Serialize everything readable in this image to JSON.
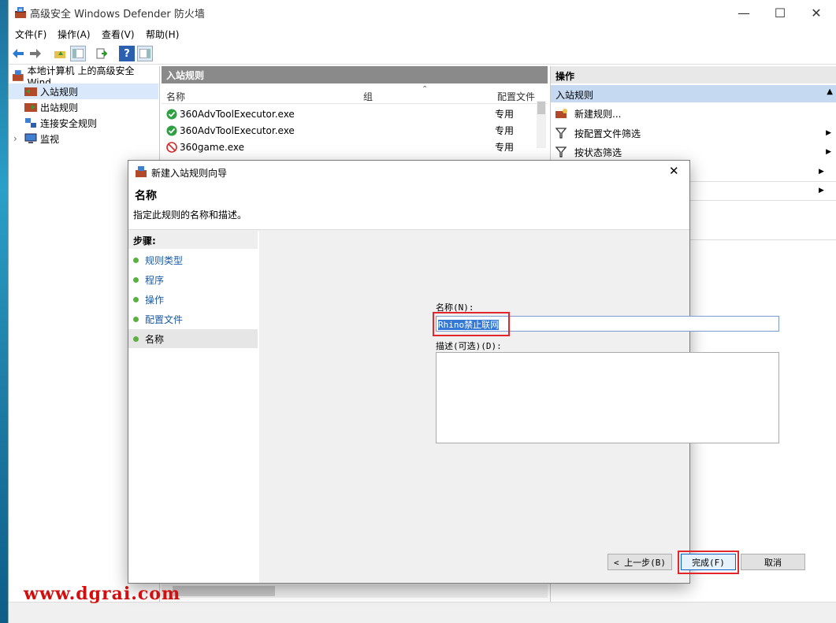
{
  "window": {
    "title": "高级安全 Windows Defender 防火墙"
  },
  "menu": [
    "文件(F)",
    "操作(A)",
    "查看(V)",
    "帮助(H)"
  ],
  "tree": {
    "root": "本地计算机 上的高级安全 Wind",
    "items": [
      "入站规则",
      "出站规则",
      "连接安全规则",
      "监视"
    ]
  },
  "middle": {
    "header": "入站规则",
    "columns": [
      "名称",
      "组",
      "配置文件"
    ],
    "rows": [
      {
        "name": "360AdvToolExecutor.exe",
        "profile": "专用",
        "status": "allow"
      },
      {
        "name": "360AdvToolExecutor.exe",
        "profile": "专用",
        "status": "allow"
      },
      {
        "name": "360game.exe",
        "profile": "专用",
        "status": "block"
      }
    ]
  },
  "actions": {
    "header": "操作",
    "sub": "入站规则",
    "items": [
      "新建规则...",
      "按配置文件筛选",
      "按状态筛选"
    ]
  },
  "dialog": {
    "title": "新建入站规则向导",
    "heading": "名称",
    "subheading": "指定此规则的名称和描述。",
    "steps_title": "步骤:",
    "steps": [
      "规则类型",
      "程序",
      "操作",
      "配置文件",
      "名称"
    ],
    "name_label": "名称(N):",
    "name_value": "Rhino禁止联网",
    "desc_label": "描述(可选)(D):",
    "back_button": "< 上一步(B)",
    "finish_button": "完成(F)",
    "cancel_button": "取消"
  },
  "watermark": "www.dgrai.com",
  "colors": {
    "accent": "#3378d6",
    "highlight_box": "#e1272c",
    "allow": "#2ea043",
    "block": "#d62b2b"
  }
}
